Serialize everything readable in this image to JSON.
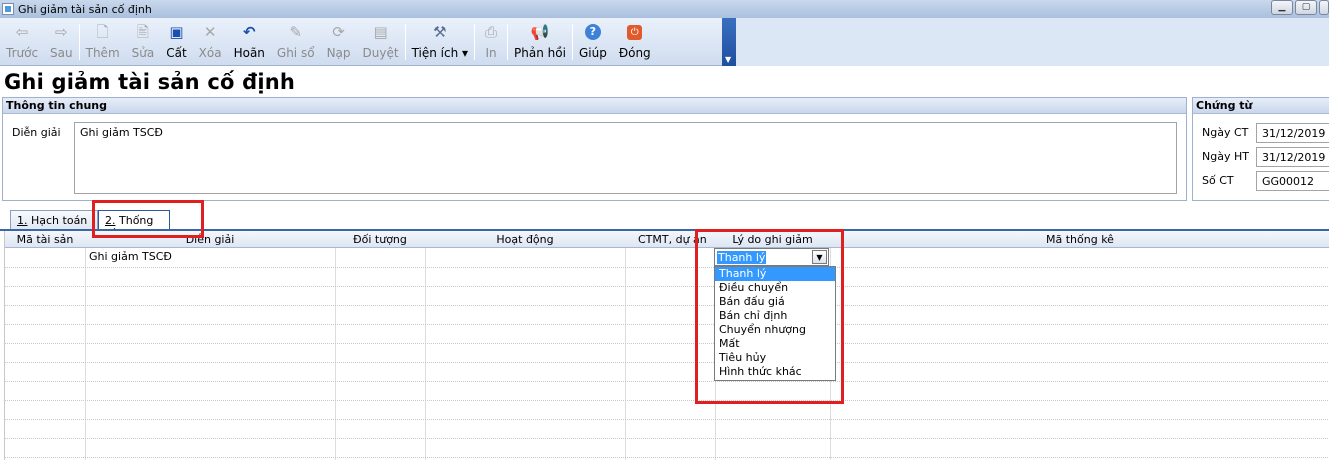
{
  "window": {
    "title": "Ghi giảm tài sản cố định"
  },
  "toolbar": {
    "buttons": [
      {
        "label": "Trước",
        "icon": "arrow-left-icon",
        "enabled": false
      },
      {
        "label": "Sau",
        "icon": "arrow-right-icon",
        "enabled": false
      },
      {
        "label": "Thêm",
        "icon": "add-document-icon",
        "enabled": false
      },
      {
        "label": "Sửa",
        "icon": "edit-document-icon",
        "enabled": false
      },
      {
        "label": "Cất",
        "icon": "save-icon",
        "enabled": true
      },
      {
        "label": "Xóa",
        "icon": "delete-icon",
        "enabled": false
      },
      {
        "label": "Hoãn",
        "icon": "undo-icon",
        "enabled": true
      },
      {
        "label": "Ghi sổ",
        "icon": "pencil-icon",
        "enabled": false
      },
      {
        "label": "Nạp",
        "icon": "reload-icon",
        "enabled": false
      },
      {
        "label": "Duyệt",
        "icon": "approve-icon",
        "enabled": false
      },
      {
        "label": "Tiện ích",
        "icon": "tools-icon",
        "enabled": true
      },
      {
        "label": "In",
        "icon": "print-icon",
        "enabled": false
      },
      {
        "label": "Phản hồi",
        "icon": "megaphone-icon",
        "enabled": true
      },
      {
        "label": "Giúp",
        "icon": "help-icon",
        "enabled": true
      },
      {
        "label": "Đóng",
        "icon": "power-icon",
        "enabled": true
      }
    ]
  },
  "page": {
    "title": "Ghi giảm tài sản cố định"
  },
  "general_info": {
    "header": "Thông tin chung",
    "description_label": "Diễn giải",
    "description_value": "Ghi giảm TSCĐ"
  },
  "voucher": {
    "header": "Chứng từ",
    "date_ct_label": "Ngày CT",
    "date_ct_value": "31/12/2019",
    "date_ht_label": "Ngày HT",
    "date_ht_value": "31/12/2019",
    "number_label": "Số CT",
    "number_value": "GG00012"
  },
  "tabs": [
    {
      "num": "1.",
      "label": "Hạch toán"
    },
    {
      "num": "2.",
      "label": "Thống kê",
      "active": true
    }
  ],
  "grid": {
    "columns": [
      "Mã tài sản",
      "Diễn giải",
      "Đối tượng",
      "Hoạt động",
      "CTMT, dự án",
      "Lý do ghi giảm",
      "Mã thống kê"
    ],
    "rows": [
      {
        "description": "Ghi giảm TSCĐ",
        "reason": "Thanh lý"
      }
    ]
  },
  "reason_dropdown": {
    "selected": "Thanh lý",
    "options": [
      "Thanh lý",
      "Điều chuyển",
      "Bán đấu giá",
      "Bán chỉ định",
      "Chuyển nhượng",
      "Mất",
      "Tiêu hủy",
      "Hình thức khác"
    ]
  },
  "colors": {
    "highlight_box": "#e02020",
    "selection": "#3399ff",
    "tab_active_border": "#2b5aa0"
  }
}
